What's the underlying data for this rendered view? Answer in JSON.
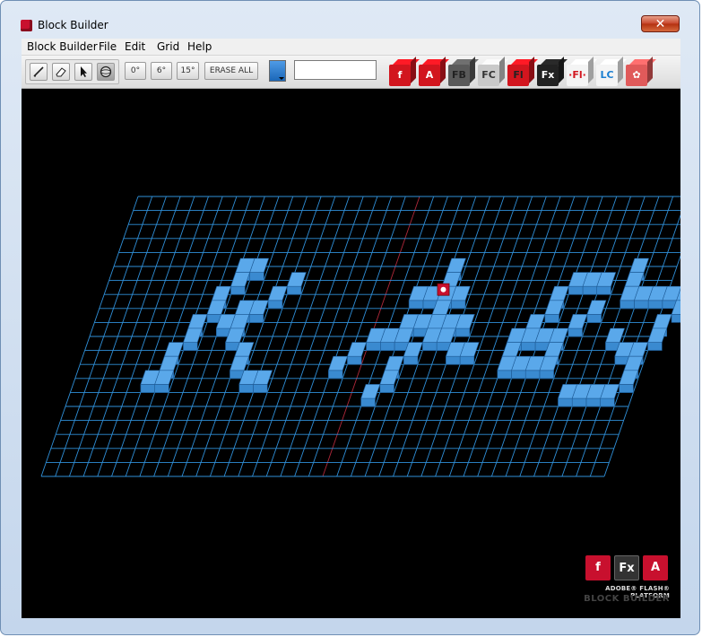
{
  "window": {
    "title": "Block Builder",
    "close_symbol": "✕"
  },
  "menu": {
    "items": [
      "Block Builder",
      "File",
      "Edit",
      "Grid",
      "Help"
    ]
  },
  "toolbar": {
    "tools": [
      {
        "name": "pencil-tool",
        "icon": "pencil-icon"
      },
      {
        "name": "eraser-tool",
        "icon": "eraser-icon"
      },
      {
        "name": "select-tool",
        "icon": "arrow-cursor-icon"
      },
      {
        "name": "rotate-tool",
        "icon": "sphere-icon",
        "active": true
      }
    ],
    "angle_buttons": [
      "0°",
      "6°",
      "15°"
    ],
    "erase_all_label": "ERASE ALL",
    "color": "#2e7fd0",
    "name_input_value": "",
    "presets": [
      {
        "label": "f",
        "color": "#d2151e",
        "text_color": "#ffffff"
      },
      {
        "label": "A",
        "color": "#d2151e",
        "text_color": "#ffffff"
      },
      {
        "label": "FB",
        "color": "#5a5a5a",
        "text_color": "#222222"
      },
      {
        "label": "FC",
        "color": "#c9c9c9",
        "text_color": "#333333"
      },
      {
        "label": "Fl",
        "color": "#d2151e",
        "text_color": "#222222"
      },
      {
        "label": "Fx",
        "color": "#222222",
        "text_color": "#ffffff"
      },
      {
        "label": "·Fl·",
        "color": "#f4f4f4",
        "text_color": "#d2151e"
      },
      {
        "label": "LC",
        "color": "#f4f4f4",
        "text_color": "#1b7fd1"
      },
      {
        "label": "✿",
        "color": "#e05a5a",
        "text_color": "#ffffff"
      }
    ]
  },
  "canvas": {
    "grid": {
      "cols": 40,
      "rows": 20,
      "color": "#2f8fd8"
    },
    "block_color": "#3a8ad0"
  },
  "logo": {
    "boxes": [
      "f",
      "Fx",
      "A"
    ],
    "line1": "ADOBE® FLASH® PLATFORM",
    "line2": "BLOCK BUILDER"
  }
}
